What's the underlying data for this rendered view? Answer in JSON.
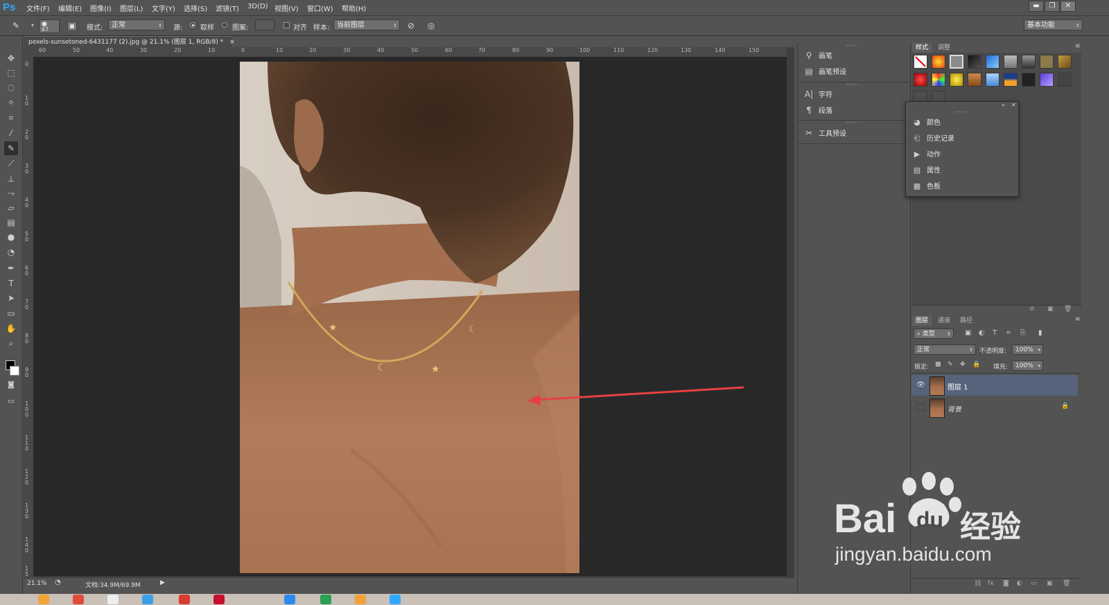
{
  "app": {
    "logo": "Ps",
    "workspace": "基本功能"
  },
  "menu": [
    "文件(F)",
    "编辑(E)",
    "图像(I)",
    "图层(L)",
    "文字(Y)",
    "选择(S)",
    "滤镜(T)",
    "3D(D)",
    "视图(V)",
    "窗口(W)",
    "帮助(H)"
  ],
  "window_controls": {
    "minimize": "▬",
    "restore": "❐",
    "close": "✕"
  },
  "options": {
    "brush_size": "67",
    "mode_label": "模式:",
    "mode_value": "正常",
    "source_label": "源:",
    "source_sampled": "取样",
    "source_pattern": "图案:",
    "aligned_label": "对齐",
    "sample_label": "样本:",
    "sample_value": "当前图层"
  },
  "document": {
    "tab_title": "pexels-sunsetoned-6431177 (2).jpg @ 21.1% (图层 1, RGB/8) *",
    "close": "×",
    "zoom": "21.1%",
    "doc_size": "文档:34.9M/69.9M"
  },
  "ruler_h": [
    "60",
    "50",
    "40",
    "30",
    "20",
    "10",
    "0",
    "10",
    "20",
    "30",
    "40",
    "50",
    "60",
    "70",
    "80",
    "90",
    "100",
    "110",
    "120",
    "130",
    "140",
    "150"
  ],
  "ruler_v": [
    "0",
    "1 0",
    "2 0",
    "3 0",
    "4 0",
    "5 0",
    "6 0",
    "7 0",
    "8 0",
    "9 0",
    "1 0 0",
    "1 1 0",
    "1 2 0",
    "1 3 0",
    "1 4 0",
    "1 5"
  ],
  "dock_panels": [
    {
      "label": "画笔",
      "icon": "brush-icon"
    },
    {
      "label": "画笔预设",
      "icon": "brush-preset-icon"
    },
    {
      "label": "字符",
      "icon": "character-icon"
    },
    {
      "label": "段落",
      "icon": "paragraph-icon"
    },
    {
      "label": "工具预设",
      "icon": "tool-preset-icon"
    }
  ],
  "styles_panel": {
    "tabs": [
      "样式",
      "调整"
    ]
  },
  "float_panel": [
    {
      "label": "颜色",
      "icon": "color-icon"
    },
    {
      "label": "历史记录",
      "icon": "history-icon"
    },
    {
      "label": "动作",
      "icon": "actions-icon"
    },
    {
      "label": "属性",
      "icon": "properties-icon"
    },
    {
      "label": "色板",
      "icon": "swatches-icon"
    }
  ],
  "layers_panel": {
    "tabs": [
      "图层",
      "通道",
      "路径"
    ],
    "filter_type": "类型",
    "blend_mode": "正常",
    "opacity_label": "不透明度:",
    "opacity_value": "100%",
    "lock_label": "锁定:",
    "fill_label": "填充:",
    "fill_value": "100%",
    "layers": [
      {
        "name": "图层 1",
        "visible": true,
        "selected": true
      },
      {
        "name": "背景",
        "visible": false,
        "locked": true
      }
    ]
  },
  "watermark": {
    "brand": "Bai",
    "brand2": "du",
    "cn": "经验",
    "url": "jingyan.baidu.com"
  },
  "colors": {
    "accent": "#31a8ff",
    "arrow": "#e84040",
    "selected_layer": "#56637a"
  }
}
